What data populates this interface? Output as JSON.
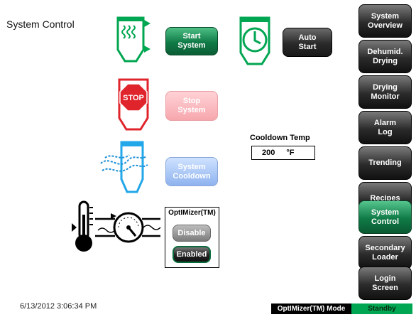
{
  "page": {
    "title": "System Control"
  },
  "controls": {
    "start_system": "Start\nSystem",
    "auto_start": "Auto\nStart",
    "stop_system": "Stop\nSystem",
    "system_cooldown": "System\nCooldown"
  },
  "cooldown": {
    "label": "Cooldown Temp",
    "value": "200",
    "unit": "°F"
  },
  "optimizer": {
    "title": "OptIMizer(TM)",
    "disable_label": "Disable",
    "enabled_label": "Enabled"
  },
  "nav": [
    {
      "label": "System\nOverview"
    },
    {
      "label": "Dehumid.\nDrying"
    },
    {
      "label": "Drying\nMonitor"
    },
    {
      "label": "Alarm\nLog"
    },
    {
      "label": "Trending"
    },
    {
      "label": "Recipes"
    },
    {
      "label": "System\nControl"
    },
    {
      "label": "Secondary\nLoader"
    },
    {
      "label": "Login\nScreen"
    }
  ],
  "status": {
    "timestamp": "6/13/2012 3:06:34 PM",
    "mode_label": "OptIMizer(TM) Mode",
    "state": "Standby"
  },
  "colors": {
    "green": "#0f7a46",
    "stop_red": "#e0242c",
    "standby_green": "#00a651"
  },
  "icons": [
    "hopper-heat-icon",
    "clock-hopper-icon",
    "stop-hopper-icon",
    "cooldown-hopper-icon",
    "thermometer-gauge-icon"
  ]
}
